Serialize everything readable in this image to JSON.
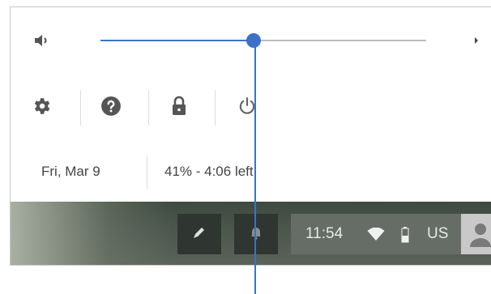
{
  "volume": {
    "level": 0.47
  },
  "status": {
    "date": "Fri, Mar 9",
    "battery": "41% - 4:06 left"
  },
  "shelf": {
    "time": "11:54",
    "language": "US"
  },
  "icons": {
    "volume": "speaker-icon",
    "expand": "chevron-right-icon",
    "settings": "gear-icon",
    "help": "help-icon",
    "lock": "lock-icon",
    "power": "power-icon",
    "stylus": "pen-icon",
    "notifications": "bell-icon",
    "wifi": "wifi-icon",
    "battery": "battery-icon",
    "account": "avatar-icon"
  },
  "colors": {
    "accent": "#3b72c8",
    "shelf": "#4a554c",
    "status_area": "#666d66"
  }
}
